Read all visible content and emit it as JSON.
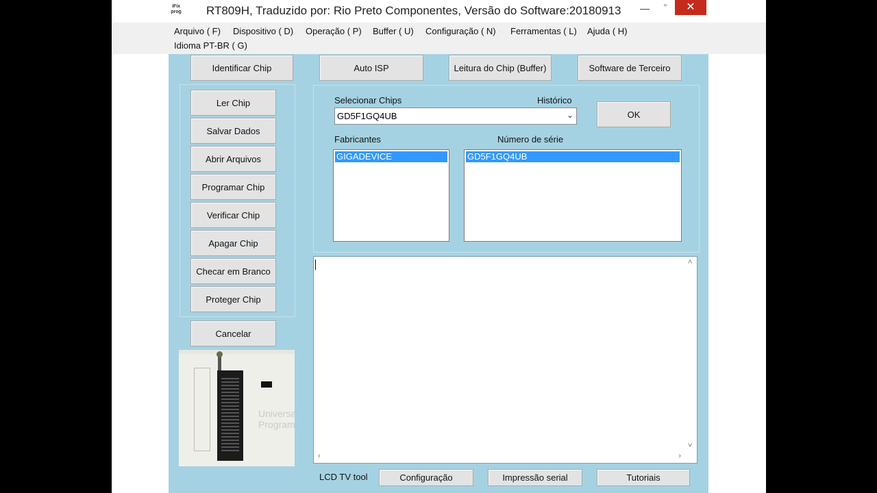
{
  "window": {
    "title": "RT809H, Traduzido por: Rio Preto Componentes, Versão do Software:20180913",
    "icon_text": "iFix prog"
  },
  "window_controls": {
    "minimize": "—",
    "maximize": "▫",
    "close": "✕"
  },
  "menu": [
    "Arquivo ( F)",
    "Dispositivo ( D)",
    "Operação ( P)",
    "Buffer ( U)",
    "Configuração ( N)",
    "Ferramentas ( L)",
    "Ajuda ( H)",
    "Idioma PT-BR ( G)"
  ],
  "top_buttons": {
    "identify": "Identificar Chip",
    "auto_isp": "Auto ISP",
    "read_buffer": "Leitura do Chip (Buffer)",
    "third_party": "Software de Terceiro"
  },
  "side_buttons": [
    "Ler Chip",
    "Salvar Dados",
    "Abrir Arquivos",
    "Programar Chip",
    "Verificar Chip",
    "Apagar Chip",
    "Checar em Branco",
    "Proteger Chip"
  ],
  "cancel_button": "Cancelar",
  "chip_select": {
    "label": "Selecionar Chips",
    "history_label": "Histórico",
    "value": "GD5F1GQ4UB",
    "ok_button": "OK"
  },
  "manufacturers": {
    "label": "Fabricantes",
    "items": [
      "GIGADEVICE"
    ]
  },
  "serial_numbers": {
    "label": "Número de série",
    "items": [
      "GD5F1GQ4UB"
    ]
  },
  "photo": {
    "overlay_text_1": "Universa",
    "overlay_text_2": "Programm"
  },
  "footer": {
    "lcd_tool": "LCD TV tool",
    "config_button": "Configuração",
    "serial_print_button": "Impressão serial",
    "tutorials_button": "Tutoriais"
  }
}
